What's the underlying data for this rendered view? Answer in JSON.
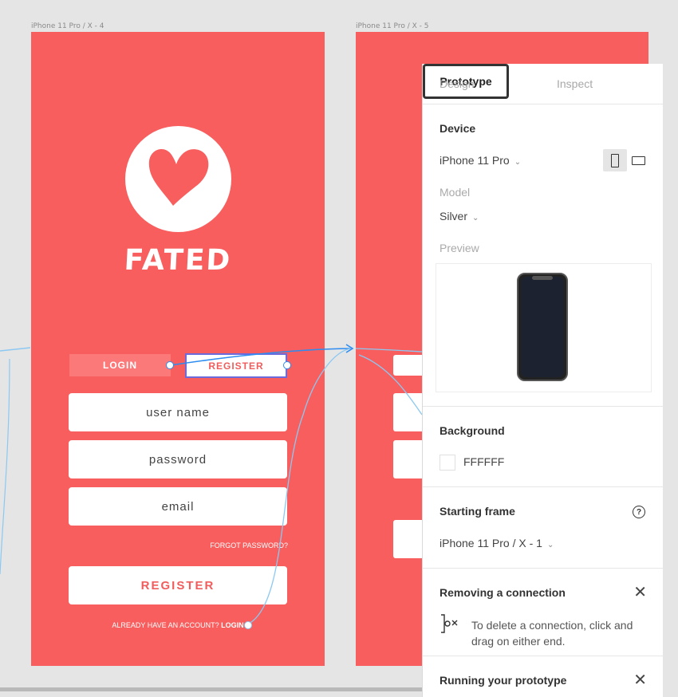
{
  "canvas": {
    "frame4_label": "iPhone 11 Pro / X - 4",
    "frame5_label": "iPhone 11 Pro / X - 5",
    "brand": "FATED",
    "login_tab": "LOGIN",
    "register_tab": "REGISTER",
    "fields": [
      "user name",
      "password",
      "email"
    ],
    "forgot_password": "FORGOT PASSWORD?",
    "register_button": "REGISTER",
    "already_have_account": "ALREADY HAVE AN ACCOUNT?",
    "login_link": "LOGIN",
    "brand_color": "#f85e5e",
    "connection_color": "#2c8cf0"
  },
  "panel": {
    "tabs": {
      "design": "Design",
      "prototype": "Prototype",
      "inspect": "Inspect",
      "active": "prototype"
    },
    "device": {
      "title": "Device",
      "value": "iPhone 11 Pro",
      "orientation": "portrait"
    },
    "model": {
      "title": "Model",
      "value": "Silver"
    },
    "preview": {
      "title": "Preview"
    },
    "background": {
      "title": "Background",
      "hex": "FFFFFF"
    },
    "starting_frame": {
      "title": "Starting frame",
      "value": "iPhone 11 Pro / X - 1"
    },
    "removing": {
      "title": "Removing a connection",
      "hint": "To delete a connection, click and drag on either end."
    },
    "running": {
      "title": "Running your prototype"
    }
  }
}
